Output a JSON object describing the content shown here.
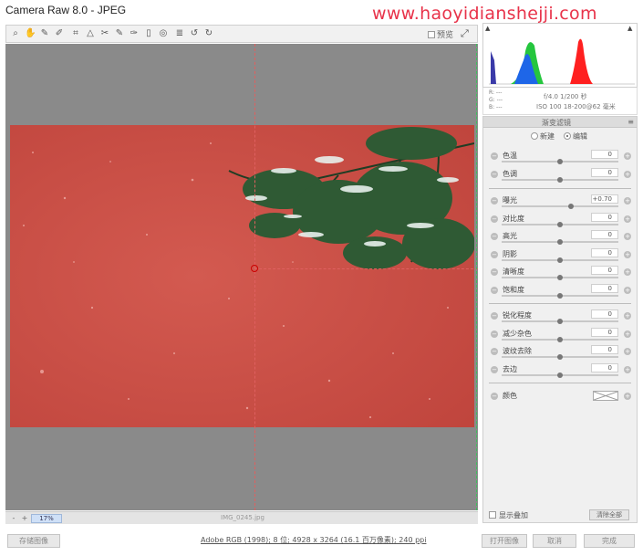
{
  "title_bar": {
    "app_title": "Camera Raw 8.0 -  JPEG",
    "watermark": "www.haoyidianshejji.com"
  },
  "toolbar": {
    "tools": [
      "zoom-icon",
      "hand-icon",
      "white-balance-icon",
      "color-sampler-icon",
      "crop-icon",
      "straighten-icon",
      "spot-removal-icon",
      "red-eye-icon",
      "adjustment-brush-icon",
      "graduated-filter-icon",
      "radial-filter-icon",
      "preferences-icon",
      "rotate-ccw-icon",
      "rotate-cw-icon"
    ],
    "preview_label": "预览"
  },
  "statusbar": {
    "zoom_minus": "-",
    "zoom_plus": "+",
    "zoom_value": "17%",
    "filename": "IMG_0245.jpg"
  },
  "histogram": {
    "rgb_labels": "R: ---\nG: ---\nB: ---",
    "exif_line1": "f/4.0   1/200 秒",
    "exif_line2": "ISO 100   18-200@62 毫米"
  },
  "panel": {
    "title": "渐变滤镜",
    "mode_new": "新建",
    "mode_edit": "编辑",
    "group1": [
      {
        "label": "色温",
        "value": "0",
        "level": 0.5
      },
      {
        "label": "色调",
        "value": "0",
        "level": 0.5
      }
    ],
    "group2": [
      {
        "label": "曝光",
        "value": "+0.70",
        "level": 0.59
      },
      {
        "label": "对比度",
        "value": "0",
        "level": 0.5
      },
      {
        "label": "高光",
        "value": "0",
        "level": 0.5
      },
      {
        "label": "阴影",
        "value": "0",
        "level": 0.5
      },
      {
        "label": "清晰度",
        "value": "0",
        "level": 0.5
      },
      {
        "label": "饱和度",
        "value": "0",
        "level": 0.5
      }
    ],
    "group3": [
      {
        "label": "锐化程度",
        "value": "0",
        "level": 0.5
      },
      {
        "label": "减少杂色",
        "value": "0",
        "level": 0.5
      },
      {
        "label": "波纹去除",
        "value": "0",
        "level": 0.5
      },
      {
        "label": "去边",
        "value": "0",
        "level": 0.5
      }
    ],
    "color_label": "颜色",
    "show_overlay": "显示叠加",
    "clear_all": "清除全部"
  },
  "bottom": {
    "save_image": "存储图像",
    "workflow": "Adobe RGB (1998); 8 位; 4928 x 3264 (16.1 百万像素); 240 ppi",
    "open_image": "打开图像",
    "cancel": "取消",
    "done": "完成"
  },
  "colors": {
    "photo_red": "#c94a42",
    "guide": "#e06060",
    "watermark": "#e8334a"
  }
}
